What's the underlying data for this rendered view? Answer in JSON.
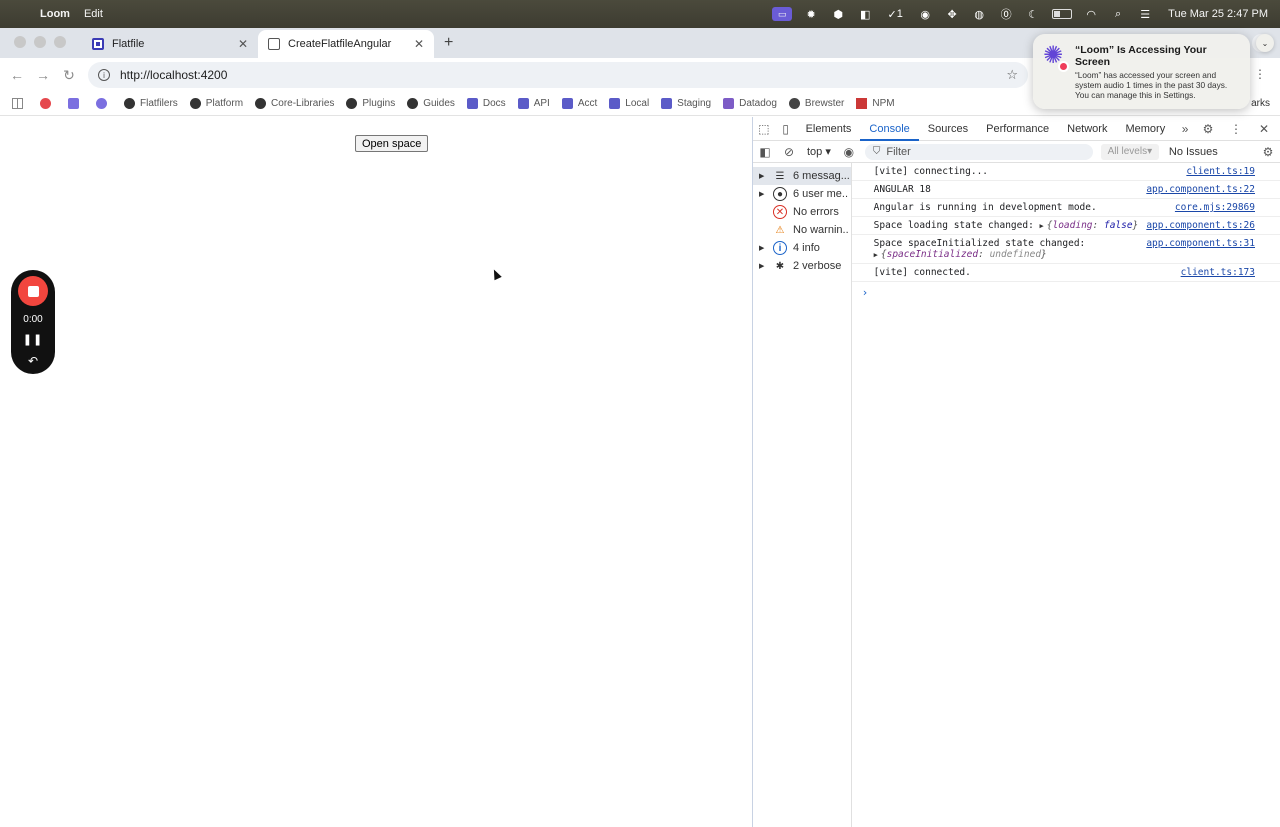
{
  "menubar": {
    "app_name": "Loom",
    "menus": [
      "Edit"
    ],
    "status_icons": [
      "recording-icon",
      "settings-icon",
      "app-icon",
      "app-icon",
      "checklist-icon",
      "target-icon",
      "move-icon",
      "shield-icon",
      "password-icon",
      "moon-icon",
      "battery-icon",
      "wifi-icon",
      "search-icon",
      "control-center-icon"
    ],
    "tasks_badge": "1",
    "clock": "Tue Mar 25  2:47 PM"
  },
  "browser": {
    "tabs": [
      {
        "title": "Flatfile",
        "active": false
      },
      {
        "title": "CreateFlatfileAngular",
        "active": true
      }
    ],
    "url": "http://localhost:4200",
    "bookmarks": [
      {
        "label": "",
        "icon": "apps-grid-icon"
      },
      {
        "label": "",
        "icon": "red-asterisk-icon"
      },
      {
        "label": "",
        "icon": "p-icon"
      },
      {
        "label": "",
        "icon": "cloud-icon"
      },
      {
        "label": "Flatfilers",
        "icon": "github-icon"
      },
      {
        "label": "Platform",
        "icon": "github-icon"
      },
      {
        "label": "Core-Libraries",
        "icon": "github-icon"
      },
      {
        "label": "Plugins",
        "icon": "github-icon"
      },
      {
        "label": "Guides",
        "icon": "github-icon"
      },
      {
        "label": "Docs",
        "icon": "flatfile-icon"
      },
      {
        "label": "API",
        "icon": "flatfile-icon"
      },
      {
        "label": "Acct",
        "icon": "flatfile-icon"
      },
      {
        "label": "Local",
        "icon": "flatfile-icon"
      },
      {
        "label": "Staging",
        "icon": "flatfile-icon"
      },
      {
        "label": "Datadog",
        "icon": "datadog-icon"
      },
      {
        "label": "Brewster",
        "icon": "brewster-icon"
      },
      {
        "label": "NPM",
        "icon": "npm-icon"
      }
    ],
    "bookmarks_overflow": "arks"
  },
  "page": {
    "open_space_button": "Open space"
  },
  "loom_recorder": {
    "timer": "0:00"
  },
  "devtools": {
    "tabs": [
      "Elements",
      "Console",
      "Sources",
      "Performance",
      "Network",
      "Memory"
    ],
    "active_tab": "Console",
    "context": "top",
    "filter_placeholder": "Filter",
    "levels": "All levels",
    "issues": "No Issues",
    "sidebar": [
      {
        "label": "6 messag...",
        "icon": "list-icon",
        "expandable": true,
        "selected": true
      },
      {
        "label": "6 user me...",
        "icon": "user-icon",
        "expandable": true,
        "selected": false
      },
      {
        "label": "No errors",
        "icon": "error-icon",
        "expandable": false,
        "selected": false
      },
      {
        "label": "No warnin...",
        "icon": "warning-icon",
        "expandable": false,
        "selected": false
      },
      {
        "label": "4 info",
        "icon": "info-icon",
        "expandable": true,
        "selected": false
      },
      {
        "label": "2 verbose",
        "icon": "bug-icon",
        "expandable": true,
        "selected": false
      }
    ],
    "messages": [
      {
        "text": "[vite] connecting...",
        "source": "client.ts:19"
      },
      {
        "text": "ANGULAR 18",
        "source": "app.component.ts:22"
      },
      {
        "text": "Angular is running in development mode.",
        "source": "core.mjs:29869"
      },
      {
        "text": "Space loading state changed:",
        "source": "app.component.ts:26",
        "object": {
          "key": "loading",
          "value": "false"
        }
      },
      {
        "text": "Space spaceInitialized state changed:",
        "source": "app.component.ts:31",
        "object": {
          "key": "spaceInitialized",
          "value": "undefined"
        }
      },
      {
        "text": "[vite] connected.",
        "source": "client.ts:173"
      }
    ]
  },
  "notification": {
    "title": "“Loom” Is Accessing Your Screen",
    "body": "“Loom” has accessed your screen and system audio 1 times in the past 30 days. You can manage this in Settings."
  }
}
